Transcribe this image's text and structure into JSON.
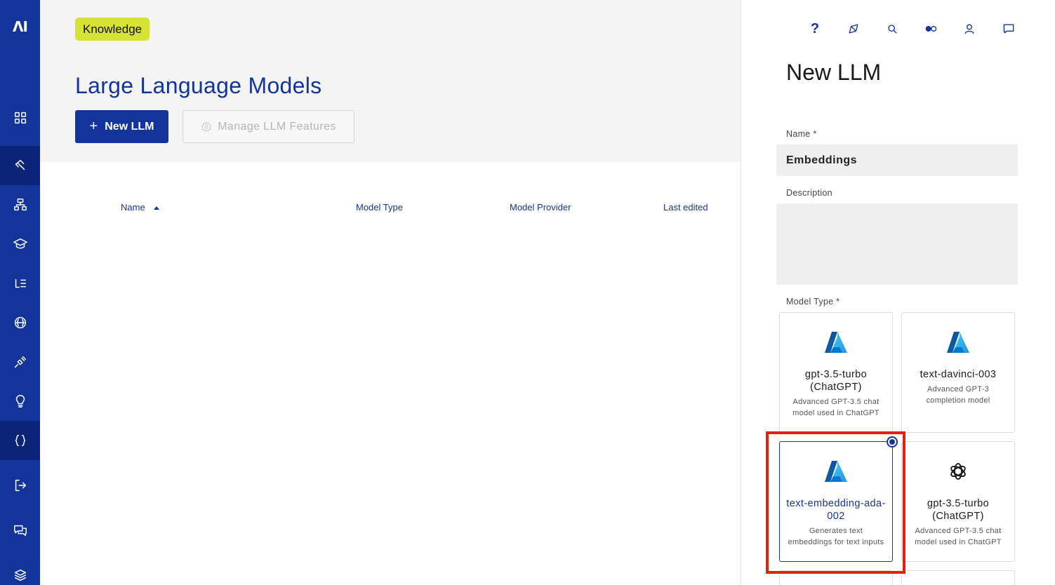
{
  "sidebar": {
    "logo": "ΛI",
    "items": [
      {
        "name": "dashboard-icon"
      },
      {
        "name": "flows-icon"
      },
      {
        "name": "endpoints-icon"
      },
      {
        "name": "training-icon"
      },
      {
        "name": "lexicon-icon"
      },
      {
        "name": "ai-brain-icon"
      },
      {
        "name": "plug-icon"
      },
      {
        "name": "insights-icon"
      },
      {
        "name": "code-icon"
      },
      {
        "name": "logout-icon"
      },
      {
        "name": "chat-icon"
      },
      {
        "name": "layers-icon"
      }
    ]
  },
  "main": {
    "badge": "Knowledge",
    "title": "Large Language Models",
    "new_button": "New LLM",
    "manage_button": "Manage LLM Features",
    "columns": [
      "Name",
      "Model Type",
      "Model Provider",
      "Last edited"
    ]
  },
  "panel": {
    "top_icons": [
      "help-icon",
      "compass-icon",
      "search-icon",
      "toggle-icon",
      "user-icon",
      "message-icon"
    ],
    "title": "New LLM",
    "name_label": "Name *",
    "name_value": "Embeddings",
    "description_label": "Description",
    "model_type_label": "Model Type *",
    "cards": [
      {
        "title": "gpt-3.5-turbo (ChatGPT)",
        "desc": "Advanced GPT-3.5 chat model used in ChatGPT",
        "provider": "azure",
        "selected": false
      },
      {
        "title": "text-davinci-003",
        "desc": "Advanced GPT-3 completion model",
        "provider": "azure",
        "selected": false
      },
      {
        "title": "text-embedding-ada-002",
        "desc": "Generates text embeddings for text inputs",
        "provider": "azure",
        "selected": true
      },
      {
        "title": "gpt-3.5-turbo (ChatGPT)",
        "desc": "Advanced GPT-3.5 chat model used in ChatGPT",
        "provider": "openai",
        "selected": false
      }
    ]
  },
  "colors": {
    "brand": "#13359b",
    "accent": "#d6e234",
    "highlight": "#e0220f"
  }
}
